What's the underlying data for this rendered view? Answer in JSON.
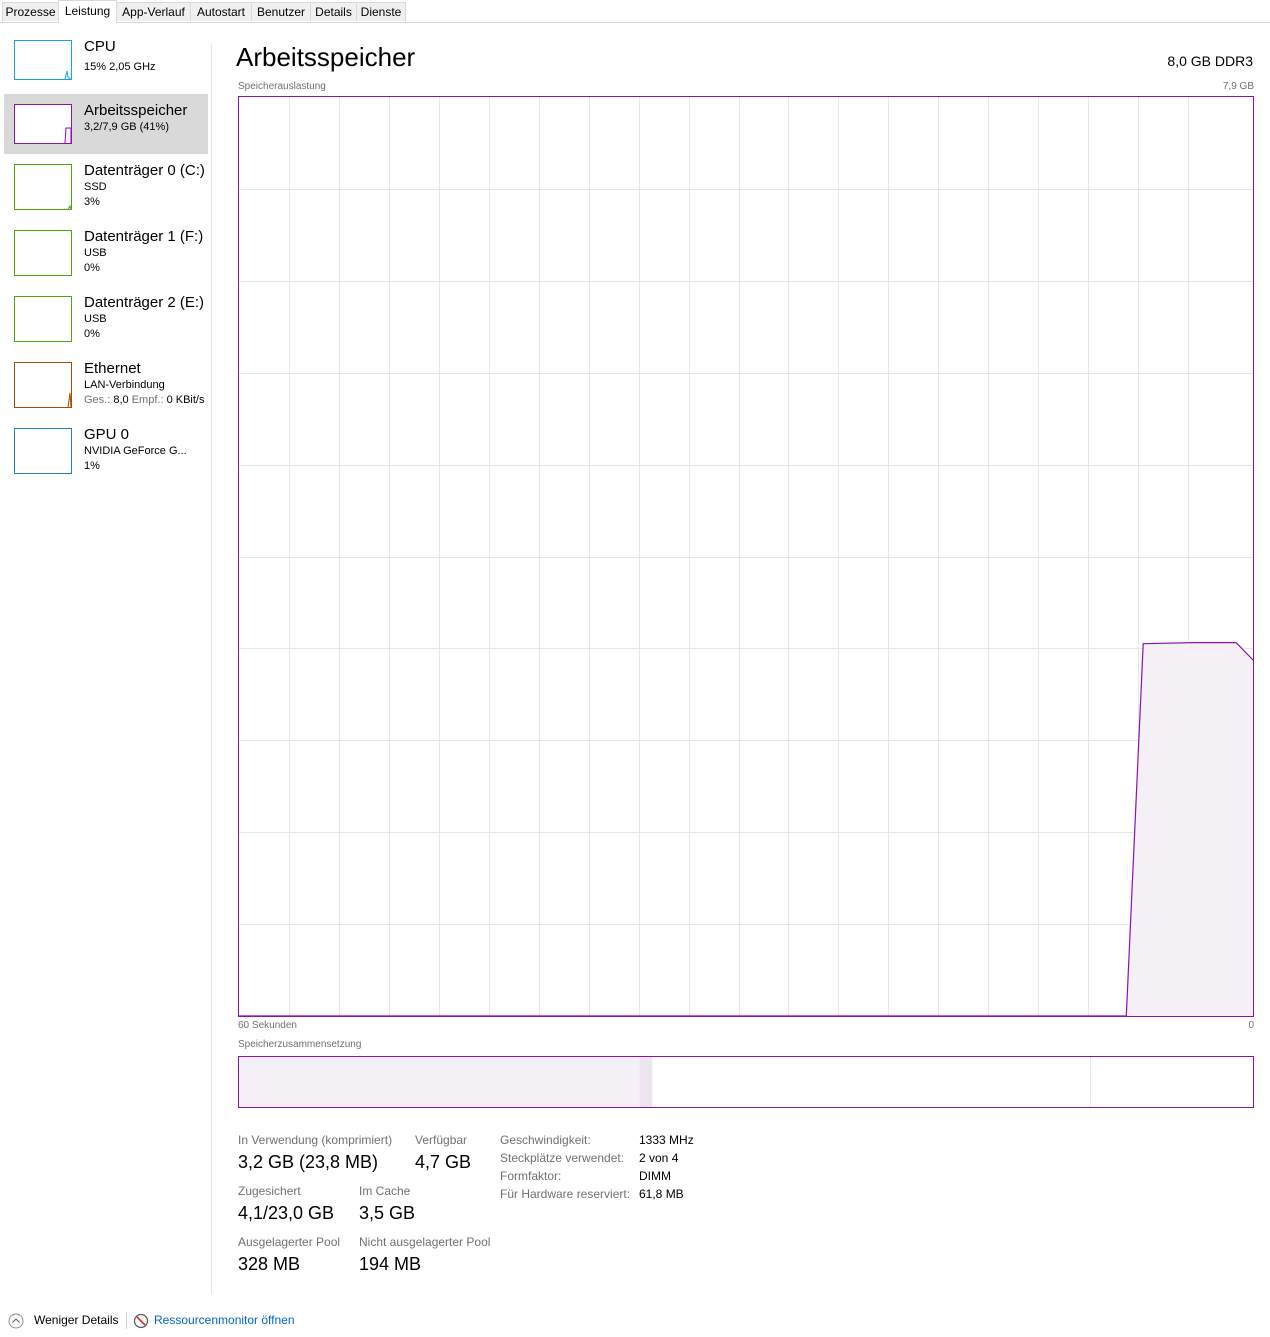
{
  "tabs": [
    "Prozesse",
    "Leistung",
    "App-Verlauf",
    "Autostart",
    "Benutzer",
    "Details",
    "Dienste"
  ],
  "sidebar": {
    "cpu": {
      "title": "CPU",
      "line1": "15%  2,05 GHz"
    },
    "memory": {
      "title": "Arbeitsspeicher",
      "line1": "3,2/7,9 GB (41%)"
    },
    "disk0": {
      "title": "Datenträger 0 (C:)",
      "line1": "SSD",
      "line2": "3%"
    },
    "disk1": {
      "title": "Datenträger 1 (F:)",
      "line1": "USB",
      "line2": "0%"
    },
    "disk2": {
      "title": "Datenträger 2 (E:)",
      "line1": "USB",
      "line2": "0%"
    },
    "ethernet": {
      "title": "Ethernet",
      "line1": "LAN-Verbindung",
      "ges_label": "Ges.:",
      "ges_value": "8,0",
      "empf_label": "Empf.:",
      "empf_value": "0 KBit/s"
    },
    "gpu": {
      "title": "GPU 0",
      "line1": "NVIDIA GeForce G...",
      "line2": "1%"
    }
  },
  "main": {
    "title": "Arbeitsspeicher",
    "memory_type": "8,0 GB DDR3",
    "graph_label": "Speicherauslastung",
    "graph_max": "7,9 GB",
    "graph_time_left": "60 Sekunden",
    "graph_time_right": "0",
    "composition_label": "Speicherzusammensetzung"
  },
  "stats": {
    "in_use_label": "In Verwendung (komprimiert)",
    "in_use_value": "3,2 GB (23,8 MB)",
    "available_label": "Verfügbar",
    "available_value": "4,7 GB",
    "committed_label": "Zugesichert",
    "committed_value": "4,1/23,0 GB",
    "cached_label": "Im Cache",
    "cached_value": "3,5 GB",
    "paged_label": "Ausgelagerter Pool",
    "paged_value": "328 MB",
    "nonpaged_label": "Nicht ausgelagerter Pool",
    "nonpaged_value": "194 MB",
    "speed_label": "Geschwindigkeit:",
    "speed_value": "1333 MHz",
    "slots_label": "Steckplätze verwendet:",
    "slots_value": "2 von 4",
    "form_label": "Formfaktor:",
    "form_value": "DIMM",
    "reserved_label": "Für Hardware reserviert:",
    "reserved_value": "61,8 MB"
  },
  "footer": {
    "fewer_details": "Weniger Details",
    "resmon": "Ressourcenmonitor öffnen"
  },
  "chart_data": {
    "type": "area",
    "xlabel": "",
    "ylabel": "",
    "x_range_seconds": [
      60,
      0
    ],
    "ylim_gb": [
      0,
      7.9
    ],
    "grid": true,
    "series": [
      {
        "x": [
          60,
          7.5,
          6.5,
          3.5,
          1.0,
          0
        ],
        "values": [
          0,
          0,
          3.2,
          3.21,
          3.21,
          3.06
        ]
      }
    ],
    "composition": [
      {
        "segment": "in_use",
        "value_gb": 3.2
      },
      {
        "segment": "modified",
        "value_gb": 0.1
      },
      {
        "segment": "standby",
        "value_gb": 3.5
      },
      {
        "segment": "free",
        "value_gb": 1.3
      }
    ]
  },
  "colors": {
    "memory": "#8b12ae",
    "cpu": "#1ba1e2",
    "disk": "#4da60c",
    "ethernet": "#a74f01",
    "gpu": "#1e7fc1",
    "fill": "#f4f0f5"
  }
}
